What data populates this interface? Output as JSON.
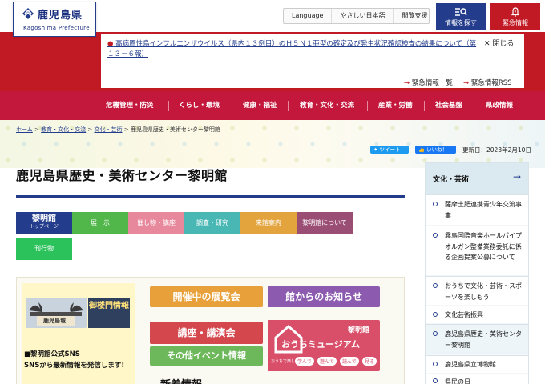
{
  "header": {
    "logo_name": "鹿児島県",
    "logo_sub": "Kagoshima Prefecture",
    "utility": [
      "Language",
      "やさしい日本語",
      "閲覧支援"
    ],
    "search_label": "情報を探す",
    "emergency_label": "緊急情報"
  },
  "emergency": {
    "headline": "高病原性鳥インフルエンザウイルス（県内１３例目）のＨ５Ｎ１亜型の確定及び発生状況確認検査の結果について（第１３－６報）",
    "close_label": "閉じる",
    "list_link": "緊急情報一覧",
    "rss_link": "緊急情報RSS"
  },
  "gnav": [
    "危機管理・防災",
    "くらし・環境",
    "健康・福祉",
    "教育・文化・交流",
    "産業・労働",
    "社会基盤",
    "県政情報"
  ],
  "breadcrumb": {
    "items": [
      "ホーム",
      "教育・文化・交流",
      "文化・芸術"
    ],
    "current": "鹿児島県歴史・美術センター黎明館",
    "sep": ">"
  },
  "share": {
    "tweet": "ツイート",
    "like": "いいね！ 29"
  },
  "updated": "更新日：2023年2月10日",
  "page_title": "鹿児島県歴史・美術センター黎明館",
  "tabs": {
    "top_big": "黎明館",
    "top_small": "トップページ",
    "items": [
      "展　示",
      "催し物・講座",
      "調査・研究",
      "来館案内",
      "黎明館について",
      "刊行物"
    ]
  },
  "content": {
    "gate_image_text": "鹿児島城",
    "gate_label": "御楼門情報",
    "sns_head": "■黎明館公式SNS",
    "sns_body": "SNSから最新情報を発信します!",
    "tiles": [
      "開催中の展覧会",
      "館からのお知らせ",
      "講座・講演会",
      "その他イベント情報"
    ],
    "museum_top": "黎明館",
    "museum_title": "おうちミュージアム",
    "museum_sub": "おうちで楽しく",
    "museum_chips": [
      "学んで",
      "遊んで",
      "読んで",
      "見る"
    ],
    "news_head": "新着情報"
  },
  "sidebar": {
    "head": "文化・芸術",
    "items": [
      "薩摩土肥連携青少年交流事業",
      "霧島国際音楽ホールパイプオルガン整備業務委託に係る企画提案公募について",
      "おうちで文化・芸術・スポーツを楽しもう",
      "文化芸術振興",
      "鹿児島県歴史・美術センター黎明館",
      "鹿児島県立博物館",
      "県民の日"
    ]
  },
  "colors": {
    "navy": "#233c8b",
    "red": "#c21a25",
    "nav": "#c4173c",
    "tab_green": "#51b74b",
    "tab_pink": "#e8889d",
    "tab_teal": "#49b7b3",
    "tab_orange": "#e3a43d",
    "tab_plum": "#9b4e74",
    "tab_bright_green": "#2bc25c",
    "tile_orange": "#e8a13a",
    "tile_purple": "#8c5bb0",
    "tile_red": "#d4474c",
    "tile_green": "#6db85a",
    "tile_pink": "#d94f6a"
  }
}
